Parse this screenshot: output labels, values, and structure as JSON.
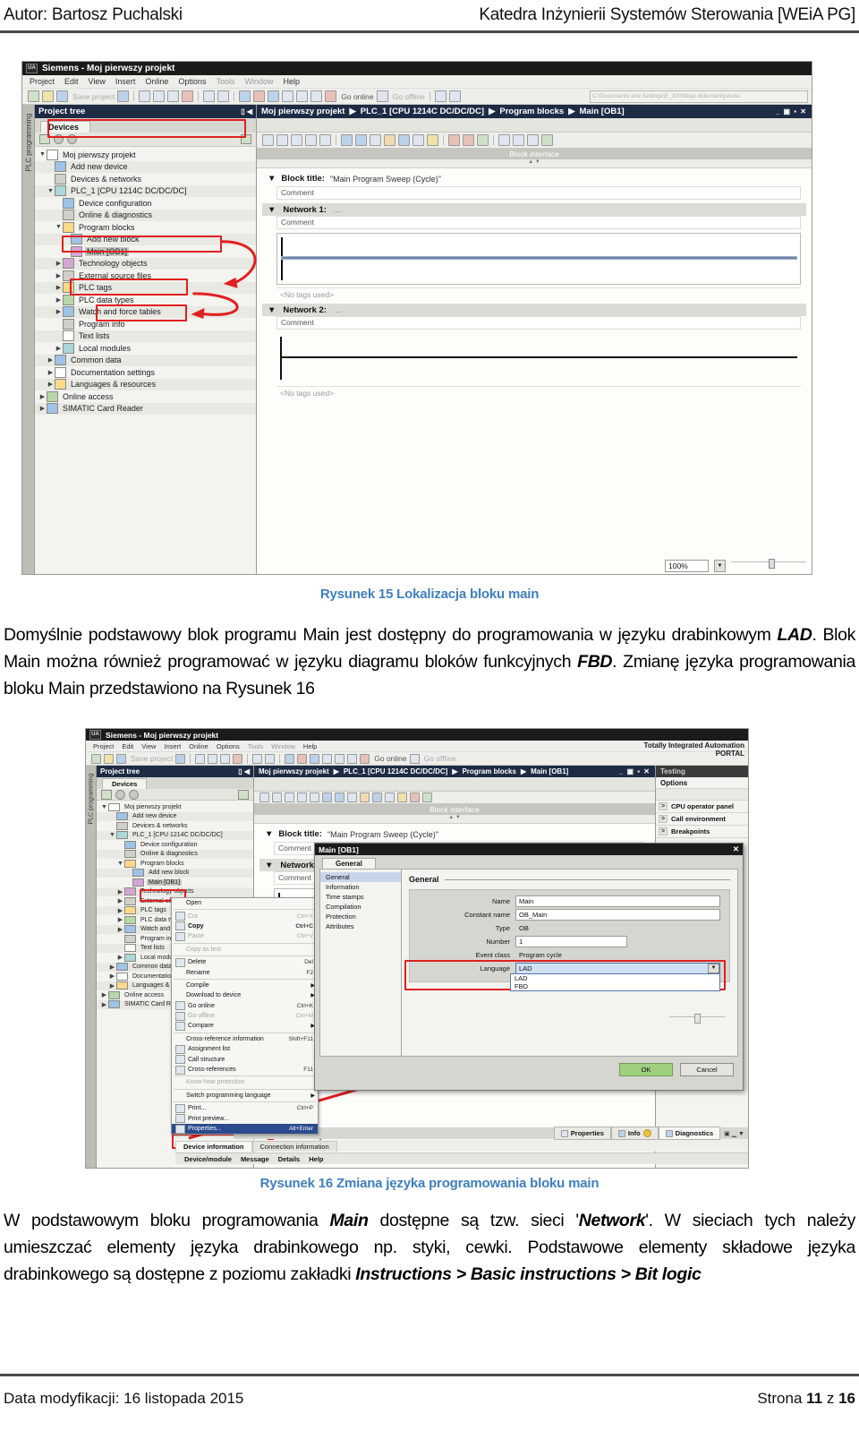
{
  "header": {
    "left": "Autor: Bartosz Puchalski",
    "right": "Katedra Inżynierii Systemów Sterowania [WEiA PG]"
  },
  "footer": {
    "left": "Data modyfikacji: 16 listopada 2015",
    "right_prefix": "Strona ",
    "page": "11",
    "right_mid": " z ",
    "total": "16"
  },
  "figures": {
    "fig1_caption": "Rysunek 15 Lokalizacja bloku main",
    "fig2_caption": "Rysunek 16 Zmiana języka programowania bloku main"
  },
  "paragraphs": {
    "p1_a": "Domyślnie podstawowy blok programu Main jest dostępny do programowania w języku drabinkowym ",
    "p1_lad": "LAD",
    "p1_b": ". Blok Main można również programować w języku diagramu bloków funkcyjnych ",
    "p1_fbd": "FBD",
    "p1_c": ". Zmianę języka programowania bloku Main przedstawiono na Rysunek 16",
    "p2_a": "W podstawowym bloku programowania ",
    "p2_main": "Main",
    "p2_b": " dostępne są tzw. sieci '",
    "p2_network": "Network",
    "p2_c": "'. W sieciach tych należy umieszczać elementy języka drabinkowego np. styki, cewki. Podstawowe elementy składowe języka drabinkowego są dostępne z poziomu zakładki ",
    "p2_path": "Instructions > Basic instructions > Bit logic"
  },
  "tia": {
    "window_title": "Siemens - Moj pierwszy projekt",
    "logo": "UA",
    "menu": [
      "Project",
      "Edit",
      "View",
      "Insert",
      "Online",
      "Options",
      "Tools",
      "Window",
      "Help"
    ],
    "menu_dim": [
      "Tools",
      "Window"
    ],
    "toolbar": {
      "save_label": "Save project",
      "go_online": "Go online",
      "go_offline": "Go offline",
      "path_box": "C:\\Documents and Settings\\E_200\\Moje dokumenty\\Auto"
    },
    "banner": "Totally Integrated Automation",
    "banner2": "PORTAL",
    "project_tree": {
      "title": "Project tree",
      "tab": "Devices",
      "items": [
        {
          "label": "Moj pierwszy projekt",
          "indent": 0,
          "arrow": "▼",
          "icon": "wht"
        },
        {
          "label": "Add new device",
          "indent": 1,
          "arrow": "",
          "icon": "blue"
        },
        {
          "label": "Devices & networks",
          "indent": 1,
          "arrow": "",
          "icon": "gry"
        },
        {
          "label": "PLC_1 [CPU 1214C DC/DC/DC]",
          "indent": 1,
          "arrow": "▼",
          "icon": "teal"
        },
        {
          "label": "Device configuration",
          "indent": 2,
          "arrow": "",
          "icon": "blue"
        },
        {
          "label": "Online & diagnostics",
          "indent": 2,
          "arrow": "",
          "icon": "gry"
        },
        {
          "label": "Program blocks",
          "indent": 2,
          "arrow": "▼",
          "icon": ""
        },
        {
          "label": "Add new block",
          "indent": 3,
          "arrow": "",
          "icon": "blue"
        },
        {
          "label": "Main [OB1]",
          "indent": 3,
          "arrow": "",
          "icon": "pur"
        },
        {
          "label": "Technology objects",
          "indent": 2,
          "arrow": "▶",
          "icon": "pur"
        },
        {
          "label": "External source files",
          "indent": 2,
          "arrow": "▶",
          "icon": "gry"
        },
        {
          "label": "PLC tags",
          "indent": 2,
          "arrow": "▶",
          "icon": ""
        },
        {
          "label": "PLC data types",
          "indent": 2,
          "arrow": "▶",
          "icon": "grn"
        },
        {
          "label": "Watch and force tables",
          "indent": 2,
          "arrow": "▶",
          "icon": "blue"
        },
        {
          "label": "Program info",
          "indent": 2,
          "arrow": "",
          "icon": "gry"
        },
        {
          "label": "Text lists",
          "indent": 2,
          "arrow": "",
          "icon": "wht"
        },
        {
          "label": "Local modules",
          "indent": 2,
          "arrow": "▶",
          "icon": "teal"
        },
        {
          "label": "Common data",
          "indent": 1,
          "arrow": "▶",
          "icon": "blue"
        },
        {
          "label": "Documentation settings",
          "indent": 1,
          "arrow": "▶",
          "icon": "wht"
        },
        {
          "label": "Languages & resources",
          "indent": 1,
          "arrow": "▶",
          "icon": ""
        },
        {
          "label": "Online access",
          "indent": 0,
          "arrow": "▶",
          "icon": "grn"
        },
        {
          "label": "SIMATIC Card Reader",
          "indent": 0,
          "arrow": "▶",
          "icon": "blue"
        }
      ]
    },
    "side_rail": "PLC programming",
    "editor": {
      "breadcrumb": [
        "Moj pierwszy projekt",
        "PLC_1 [CPU 1214C DC/DC/DC]",
        "Program blocks",
        "Main [OB1]"
      ],
      "separator": "▶",
      "block_interface": "Block interface",
      "block_title_label": "Block title:",
      "block_title_value": "\"Main Program Sweep (Cycle)\"",
      "comment": "Comment",
      "networks": [
        {
          "label": "Network 1:",
          "dots": "....",
          "comment": "Comment",
          "notags": "<No tags used>"
        },
        {
          "label": "Network 2:",
          "dots": "....",
          "comment": "Comment",
          "notags": "<No tags used>"
        }
      ],
      "zoom": "100%"
    },
    "right_pane": {
      "title": "Testing",
      "subtitle": "Options",
      "rows": [
        "CPU operator panel",
        "Call environment",
        "Breakpoints"
      ]
    },
    "context_menu": {
      "items": [
        {
          "label": "Open",
          "key": "",
          "sub": "",
          "dim": false,
          "icon": ""
        },
        {
          "sep": true
        },
        {
          "label": "Cut",
          "key": "Ctrl+X",
          "sub": "",
          "dim": true,
          "icon": "cut-icon"
        },
        {
          "label": "Copy",
          "key": "Ctrl+C",
          "sub": "",
          "dim": false,
          "icon": "copy-icon",
          "bold": true
        },
        {
          "label": "Paste",
          "key": "Ctrl+V",
          "sub": "",
          "dim": true,
          "icon": "paste-icon"
        },
        {
          "sep": true
        },
        {
          "label": "Copy as text",
          "key": "",
          "sub": "",
          "dim": true,
          "icon": ""
        },
        {
          "sep": true
        },
        {
          "label": "Delete",
          "key": "Del",
          "sub": "",
          "dim": false,
          "icon": "delete-icon"
        },
        {
          "label": "Rename",
          "key": "F2",
          "sub": "",
          "dim": false,
          "icon": ""
        },
        {
          "sep": true
        },
        {
          "label": "Compile",
          "key": "",
          "sub": "▶",
          "dim": false,
          "icon": ""
        },
        {
          "label": "Download to device",
          "key": "",
          "sub": "▶",
          "dim": false,
          "icon": ""
        },
        {
          "label": "Go online",
          "key": "Ctrl+K",
          "sub": "",
          "dim": false,
          "icon": "online-icon"
        },
        {
          "label": "Go offline",
          "key": "Ctrl+M",
          "sub": "",
          "dim": true,
          "icon": "offline-icon"
        },
        {
          "label": "Compare",
          "key": "",
          "sub": "▶",
          "dim": false,
          "icon": "compare-icon"
        },
        {
          "sep": true
        },
        {
          "label": "Cross-reference information",
          "key": "Shift+F11",
          "sub": "",
          "dim": false,
          "icon": ""
        },
        {
          "label": "Assignment list",
          "key": "",
          "sub": "",
          "dim": false,
          "icon": "list-icon"
        },
        {
          "label": "Call structure",
          "key": "",
          "sub": "",
          "dim": false,
          "icon": "call-icon"
        },
        {
          "label": "Cross-references",
          "key": "F11",
          "sub": "",
          "dim": false,
          "icon": "xref-icon"
        },
        {
          "sep": true
        },
        {
          "label": "Know-how protection",
          "key": "",
          "sub": "",
          "dim": true,
          "icon": ""
        },
        {
          "sep": true
        },
        {
          "label": "Switch programming language",
          "key": "",
          "sub": "▶",
          "dim": false,
          "icon": ""
        },
        {
          "sep": true
        },
        {
          "label": "Print...",
          "key": "Ctrl+P",
          "sub": "",
          "dim": false,
          "icon": "print-icon"
        },
        {
          "label": "Print preview...",
          "key": "",
          "sub": "",
          "dim": false,
          "icon": "preview-icon"
        },
        {
          "label": "Properties...",
          "key": "Alt+Enter",
          "sub": "",
          "dim": false,
          "icon": "props-icon",
          "hl": true
        }
      ]
    },
    "dialog": {
      "title": "Main [OB1]",
      "tab": "General",
      "nav": [
        "General",
        "Information",
        "Time stamps",
        "Compilation",
        "Protection",
        "Attributes"
      ],
      "nav_selected": "General",
      "section": "General",
      "fields": [
        {
          "label": "Name",
          "value": "Main",
          "type": "input"
        },
        {
          "label": "Constant name",
          "value": "OB_Main",
          "type": "input"
        },
        {
          "label": "Type",
          "value": "OB",
          "type": "ro"
        },
        {
          "label": "Number",
          "value": "1",
          "type": "input-short"
        },
        {
          "label": "Event class",
          "value": "Program cycle",
          "type": "ro"
        },
        {
          "label": "Language",
          "value": "LAD",
          "type": "select"
        }
      ],
      "language_options": [
        "LAD",
        "FBD"
      ],
      "ok": "OK",
      "cancel": "Cancel"
    },
    "bottom_tabs": [
      {
        "label": "Properties",
        "icon": "props-icon",
        "active": false
      },
      {
        "label": "Info",
        "icon": "info-icon",
        "badge": "i",
        "active": false
      },
      {
        "label": "Diagnostics",
        "icon": "diag-icon",
        "active": true
      }
    ],
    "bottom_subtabs": [
      "Device information",
      "Connection information"
    ],
    "bottom_status": "offline",
    "bottom_columns": [
      "Device/module",
      "Message",
      "Details",
      "Help"
    ]
  }
}
